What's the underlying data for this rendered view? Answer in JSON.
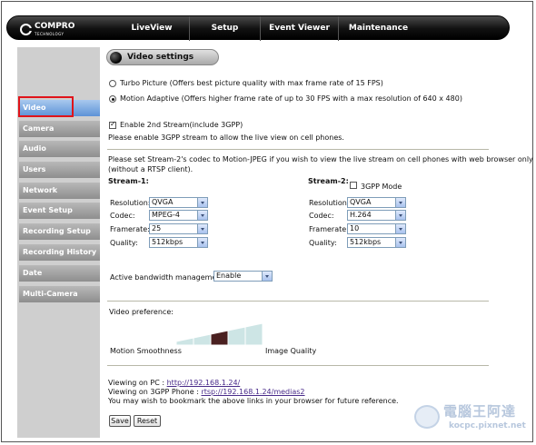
{
  "brand": {
    "name": "COMPRO",
    "sub": "TECHNOLOGY"
  },
  "nav": [
    {
      "label": "LiveView"
    },
    {
      "label": "Setup"
    },
    {
      "label": "Event Viewer"
    },
    {
      "label": "Maintenance"
    }
  ],
  "sidebar": [
    {
      "label": "Video",
      "active": true
    },
    {
      "label": "Camera"
    },
    {
      "label": "Audio"
    },
    {
      "label": "Users"
    },
    {
      "label": "Network"
    },
    {
      "label": "Event Setup"
    },
    {
      "label": "Recording Setup"
    },
    {
      "label": "Recording History"
    },
    {
      "label": "Date"
    },
    {
      "label": "Multi-Camera"
    }
  ],
  "page_title": "Video settings",
  "modes": {
    "turbo": "Turbo Picture (Offers best picture quality with max frame rate of 15 FPS)",
    "motion": "Motion Adaptive (Offers higher frame rate of up to 30 FPS with a max resolution of 640 x 480)",
    "selected": "motion"
  },
  "second_stream": {
    "checkbox_label": "Enable 2nd Stream(include 3GPP)",
    "checked": true,
    "note": "Please enable 3GPP stream to allow the live view on cell phones."
  },
  "stream_note_line1": "Please set Stream-2's codec to Motion-JPEG if you wish to view the live stream on cell phones with web browser only",
  "stream_note_line2": "(without a RTSP client).",
  "stream1": {
    "title": "Stream-1:",
    "fields": [
      {
        "label": "Resolution:",
        "value": "QVGA"
      },
      {
        "label": "Codec:",
        "value": "MPEG-4"
      },
      {
        "label": "Framerate:",
        "value": "25"
      },
      {
        "label": "Quality:",
        "value": "512kbps"
      }
    ]
  },
  "stream2": {
    "title": "Stream-2:",
    "gpp_label": "3GPP Mode",
    "gpp_checked": false,
    "fields": [
      {
        "label": "Resolution:",
        "value": "QVGA"
      },
      {
        "label": "Codec:",
        "value": "H.264"
      },
      {
        "label": "Framerate:",
        "value": "10"
      },
      {
        "label": "Quality:",
        "value": "512kbps"
      }
    ]
  },
  "bandwidth": {
    "label": "Active bandwidth management:",
    "value": "Enable"
  },
  "preference": {
    "title": "Video preference:",
    "left": "Motion Smoothness",
    "right": "Image Quality",
    "level": 3,
    "steps": 5
  },
  "links": {
    "pc_label": "Viewing on PC : ",
    "pc_url": "http://192.168.1.24/",
    "gpp_label": "Viewing on 3GPP Phone : ",
    "gpp_url": "rtsp://192.168.1.24/medias2",
    "bookmark": "You may wish to bookmark the above links in your browser for future reference."
  },
  "buttons": {
    "save": "Save",
    "reset": "Reset"
  },
  "watermark": {
    "big": "電腦王阿達",
    "small": "kocpc.pixnet.net"
  },
  "colors": {
    "accent": "#5d92d7",
    "highlight": "#e0141a",
    "bar": "#cde5e5",
    "bar_selected": "#4a2020"
  }
}
